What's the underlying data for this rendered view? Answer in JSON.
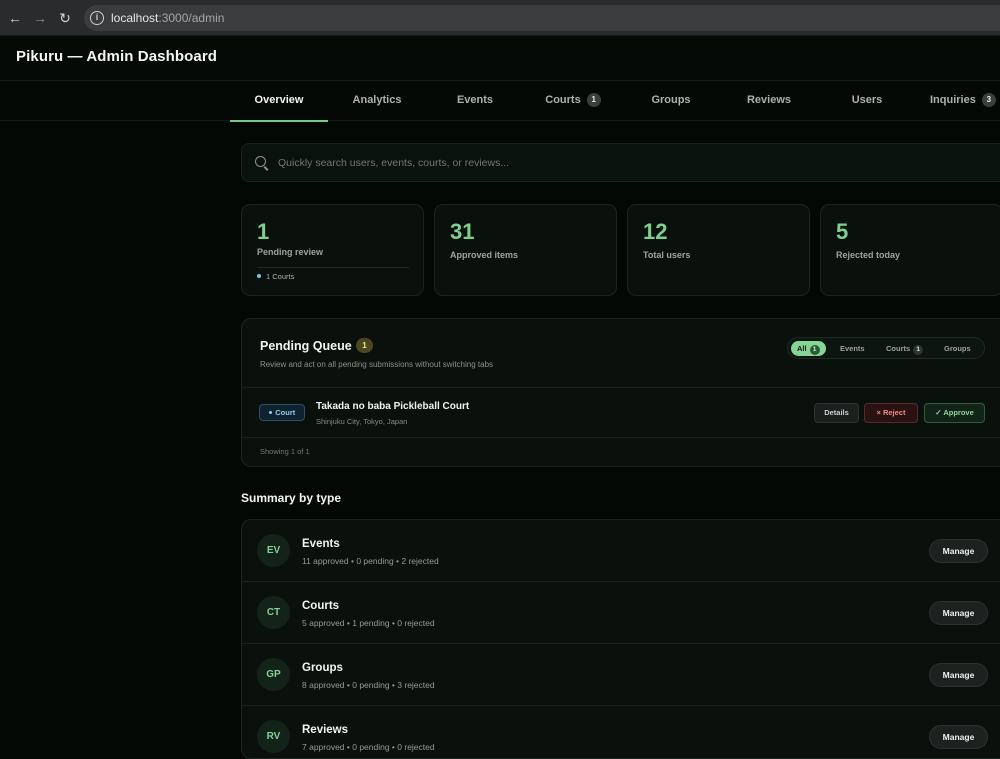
{
  "browser": {
    "url_host": "localhost",
    "url_path": ":3000/admin"
  },
  "header": {
    "title": "Pikuru — Admin Dashboard"
  },
  "tabs": [
    {
      "label": "Overview",
      "active": true
    },
    {
      "label": "Analytics"
    },
    {
      "label": "Events"
    },
    {
      "label": "Courts",
      "badge": "1"
    },
    {
      "label": "Groups"
    },
    {
      "label": "Reviews"
    },
    {
      "label": "Users"
    },
    {
      "label": "Inquiries",
      "badge": "3"
    }
  ],
  "search": {
    "placeholder": "Quickly search users, events, courts, or reviews..."
  },
  "stats": [
    {
      "value": "1",
      "label": "Pending review",
      "note": "1 Courts"
    },
    {
      "value": "31",
      "label": "Approved items"
    },
    {
      "value": "12",
      "label": "Total users"
    },
    {
      "value": "5",
      "label": "Rejected today"
    }
  ],
  "queue": {
    "title": "Pending Queue",
    "count": "1",
    "subtitle": "Review and act on all pending submissions without switching tabs",
    "filters": [
      {
        "label": "All",
        "badge": "1",
        "active": true
      },
      {
        "label": "Events"
      },
      {
        "label": "Courts",
        "badge": "1"
      },
      {
        "label": "Groups"
      }
    ],
    "items": [
      {
        "tag": "Court",
        "title": "Takada no baba Pickleball Court",
        "location": "Shinjuku City, Tokyo, Japan",
        "details_label": "Details",
        "reject_label": "× Reject",
        "approve_label": "✓ Approve"
      }
    ],
    "footer": "Showing 1 of 1"
  },
  "summary": {
    "heading": "Summary by type",
    "manage_label": "Manage",
    "rows": [
      {
        "abbr": "EV",
        "title": "Events",
        "sub": "11 approved • 0 pending • 2 rejected"
      },
      {
        "abbr": "CT",
        "title": "Courts",
        "sub": "5 approved • 1 pending • 0 rejected"
      },
      {
        "abbr": "GP",
        "title": "Groups",
        "sub": "8 approved • 0 pending • 3 rejected"
      },
      {
        "abbr": "RV",
        "title": "Reviews",
        "sub": "7 approved • 0 pending • 0 rejected"
      }
    ]
  },
  "colors": {
    "accent": "#7fd08f",
    "background": "#030805",
    "card": "#0a110c",
    "reject": "#f08a8a",
    "court_tag": "#8fd0ef"
  }
}
